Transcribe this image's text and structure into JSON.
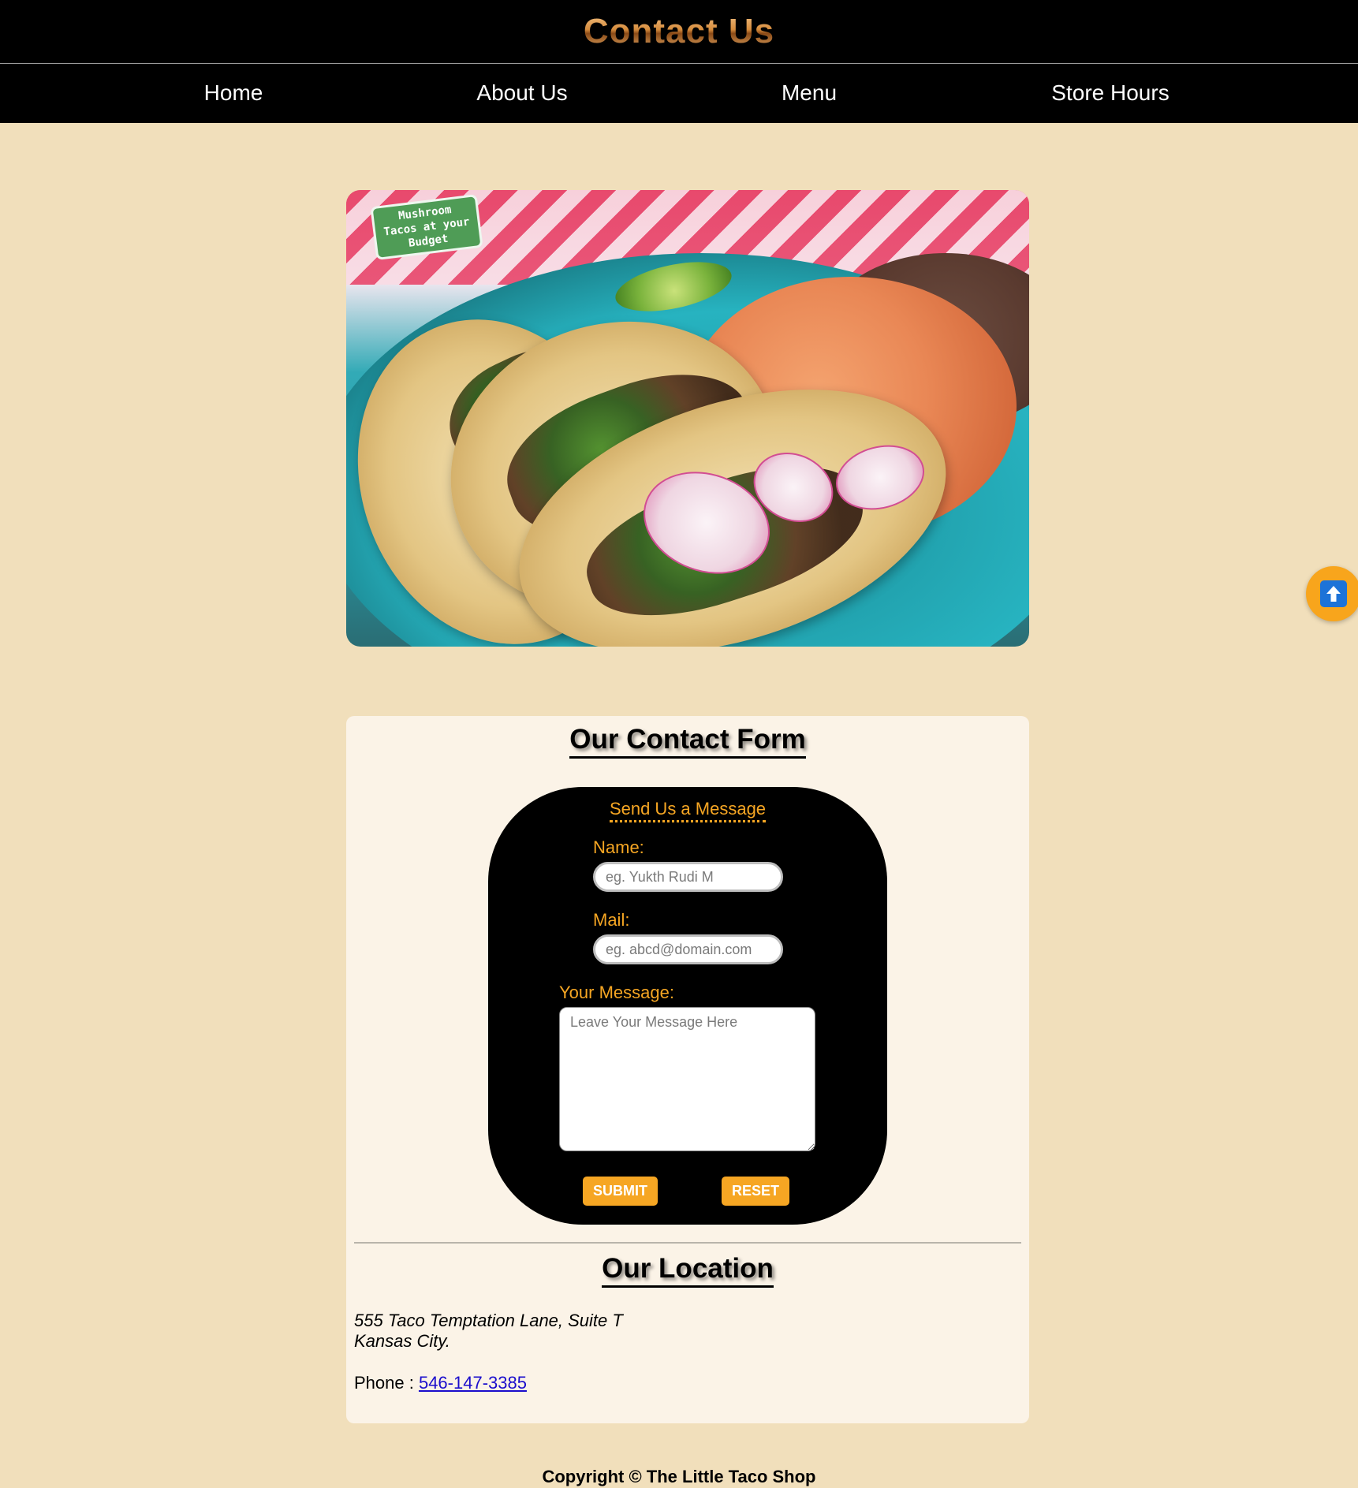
{
  "header": {
    "title": "Contact Us"
  },
  "nav": {
    "items": [
      {
        "label": "Home"
      },
      {
        "label": "About Us"
      },
      {
        "label": "Menu"
      },
      {
        "label": "Store Hours"
      }
    ]
  },
  "hero": {
    "badge_line1": "Mushroom",
    "badge_line2": "Tacos at your",
    "badge_line3": "Budget"
  },
  "contact": {
    "title": "Our Contact Form",
    "form": {
      "heading": "Send Us a Message",
      "name_label": "Name:",
      "name_placeholder": "eg. Yukth Rudi M",
      "name_value": "",
      "mail_label": "Mail:",
      "mail_placeholder": "eg. abcd@domain.com",
      "mail_value": "",
      "message_label": "Your Message:",
      "message_placeholder": "Leave Your Message Here",
      "message_value": "",
      "submit_label": "SUBMIT",
      "reset_label": "RESET"
    }
  },
  "location": {
    "title": "Our Location",
    "address_line1": "555 Taco Temptation Lane, Suite T",
    "address_line2": "Kansas City.",
    "phone_label": "Phone : ",
    "phone_number": "546-147-3385"
  },
  "footer": {
    "copyright": "Copyright © The Little Taco Shop"
  },
  "colors": {
    "page_background": "#f1dfbb",
    "accent_orange": "#f6a623",
    "card_background": "#fbf3e7",
    "badge_green": "#4f9c56",
    "link_blue": "#1a0dcc"
  },
  "icons": {
    "scroll_top": "arrow-up-icon"
  }
}
